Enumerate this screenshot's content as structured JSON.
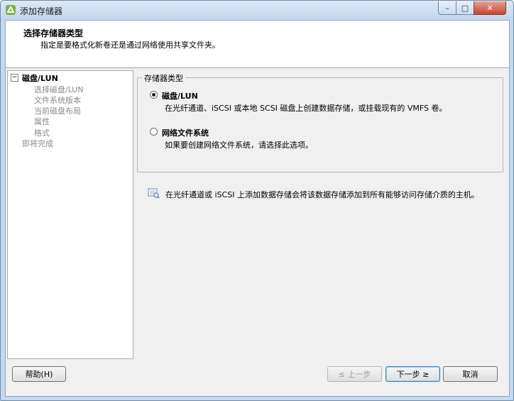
{
  "window": {
    "title": "添加存储器",
    "controls": {
      "minimize": "–",
      "maximize": "□",
      "close": "✕"
    }
  },
  "header": {
    "title": "选择存储器类型",
    "subtitle": "指定是要格式化新卷还是通过网络使用共享文件夹。"
  },
  "tree": {
    "toggle": "−",
    "items": [
      {
        "label": "磁盘/LUN",
        "level": 0,
        "style": "bold"
      },
      {
        "label": "选择磁盘/LUN",
        "level": 1,
        "style": "grey"
      },
      {
        "label": "文件系统版本",
        "level": 1,
        "style": "grey"
      },
      {
        "label": "当前磁盘布局",
        "level": 1,
        "style": "grey"
      },
      {
        "label": "属性",
        "level": 1,
        "style": "grey"
      },
      {
        "label": "格式",
        "level": 1,
        "style": "grey"
      },
      {
        "label": "即将完成",
        "level": 0,
        "style": "grey"
      }
    ]
  },
  "storage_type": {
    "legend": "存储器类型",
    "options": [
      {
        "label": "磁盘/LUN",
        "description": "在光纤通道、iSCSI 或本地 SCSI 磁盘上创建数据存储，或挂载现有的 VMFS 卷。",
        "selected": true
      },
      {
        "label": "网络文件系统",
        "description": "如果要创建网络文件系统，请选择此选项。",
        "selected": false
      }
    ]
  },
  "info": {
    "icon": "info-icon",
    "text": "在光纤通道或 iSCSI 上添加数据存储会将该数据存储添加到所有能够访问存储介质的主机。"
  },
  "buttons": {
    "help": "帮助(H)",
    "back": "≤ 上一步",
    "next": "下一步 ≥",
    "cancel": "取消"
  }
}
